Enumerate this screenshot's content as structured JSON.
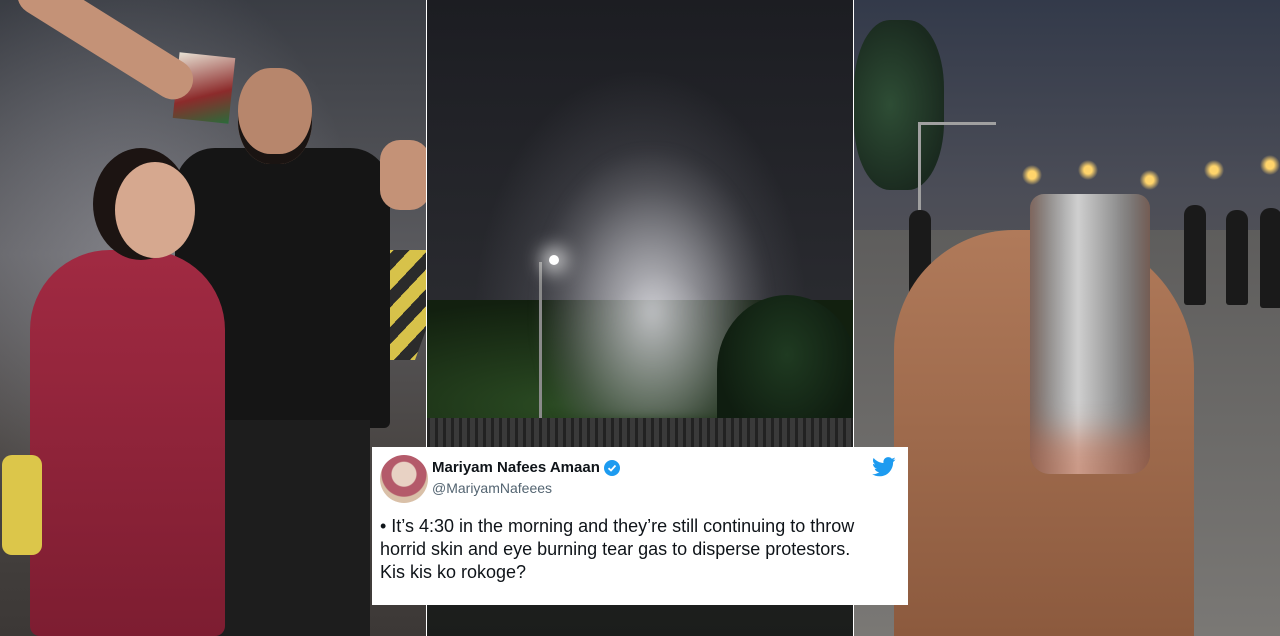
{
  "collage": {
    "panels": [
      {
        "name": "photo-couple-at-protest"
      },
      {
        "name": "photo-tear-gas-smoke"
      },
      {
        "name": "photo-tear-gas-canister"
      }
    ]
  },
  "tweet": {
    "display_name": "Mariyam Nafees Amaan",
    "handle": "@MariyamNafeees",
    "verified": true,
    "text": "• It’s 4:30 in the morning and they’re still continuing to throw horrid skin and eye burning tear gas to disperse protestors. Kis kis ko rokoge?",
    "brand_icon": "twitter-bird-icon",
    "brand_color": "#1d9bf0"
  }
}
